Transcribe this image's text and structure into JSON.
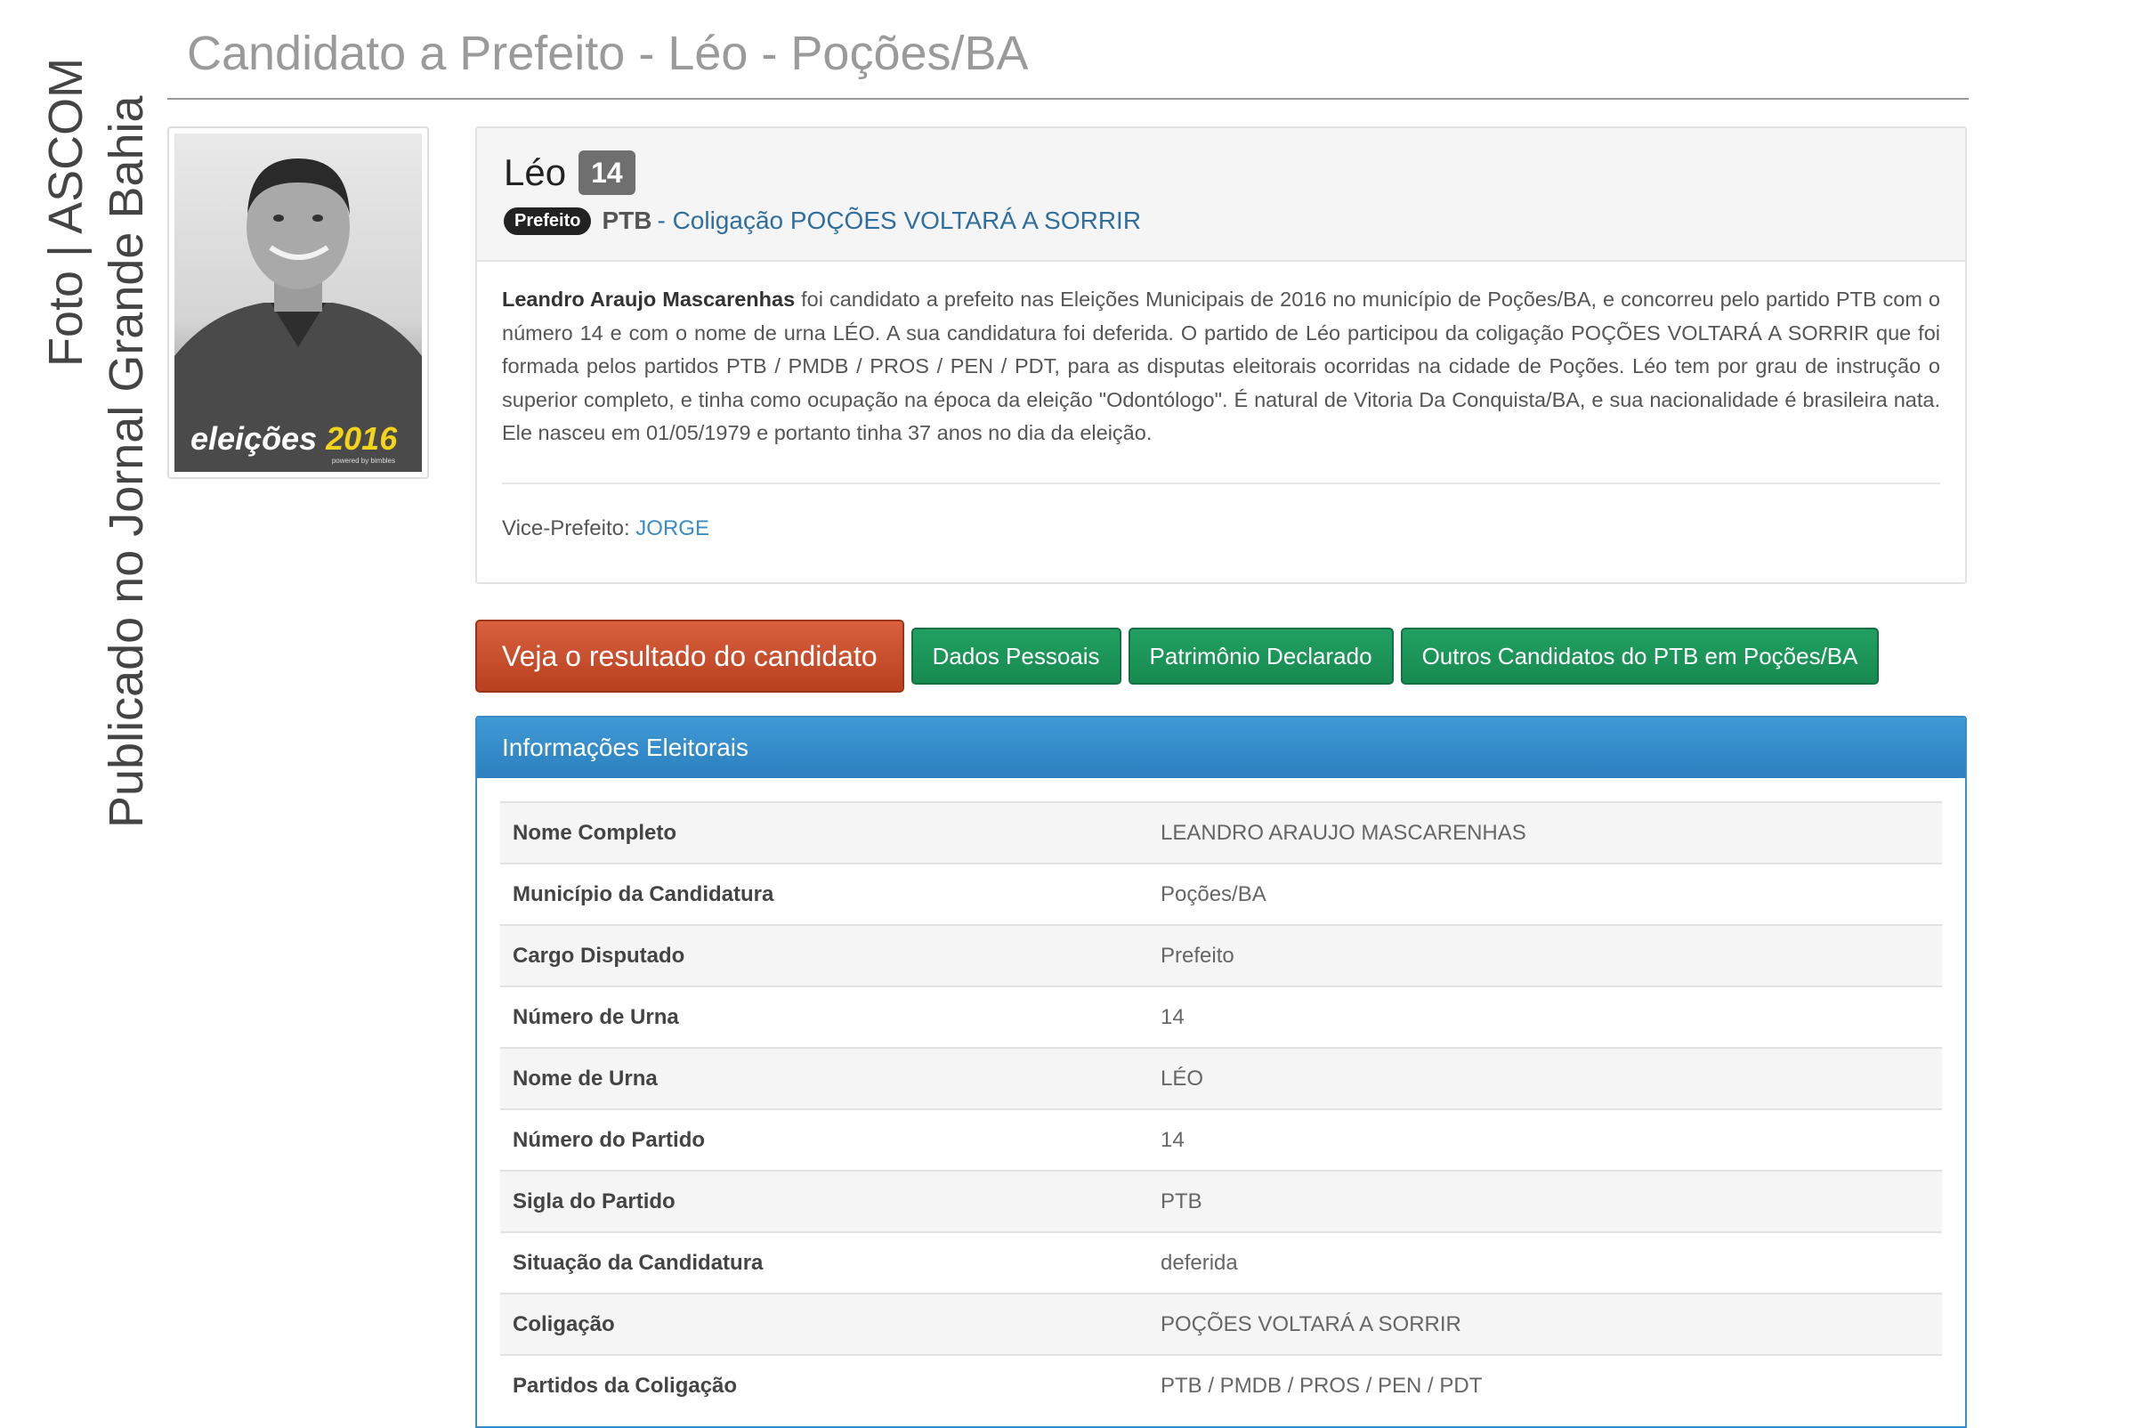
{
  "watermark": {
    "line1": "Foto | ASCOM",
    "line2": "Publicado no Jornal Grande Bahia"
  },
  "page": {
    "title": "Candidato a Prefeito - Léo - Poções/BA"
  },
  "photo": {
    "caption_word": "eleições",
    "caption_year": "2016",
    "caption_sub": "powered by bimbles"
  },
  "profile": {
    "name": "Léo",
    "number": "14",
    "role": "Prefeito",
    "party": "PTB",
    "coalition": "- Coligação POÇÕES VOLTARÁ A SORRIR",
    "bio_name": "Leandro Araujo Mascarenhas",
    "bio_text": " foi candidato a prefeito nas Eleições Municipais de 2016 no município de Poções/BA, e concorreu pelo partido PTB com o número 14 e com o nome de urna LÉO. A sua candidatura foi deferida. O partido de Léo participou da coligação POÇÕES VOLTARÁ A SORRIR que foi formada pelos partidos PTB / PMDB / PROS / PEN / PDT, para as disputas eleitorais ocorridas na cidade de Poções. Léo tem por grau de instrução o superior completo, e tinha como ocupação na época da eleição \"Odontólogo\". É natural de Vitoria Da Conquista/BA, e sua nacionalidade é brasileira nata. Ele nasceu em 01/05/1979 e portanto tinha 37 anos no dia da eleição.",
    "vice_label": "Vice-Prefeito: ",
    "vice_name": "JORGE"
  },
  "buttons": {
    "result": "Veja o resultado do candidato",
    "personal": "Dados Pessoais",
    "assets": "Patrimônio Declarado",
    "others": "Outros Candidatos do PTB em Poções/BA"
  },
  "info": {
    "title": "Informações Eleitorais",
    "rows": [
      {
        "label": "Nome Completo",
        "value": "LEANDRO ARAUJO MASCARENHAS"
      },
      {
        "label": "Município da Candidatura",
        "value": "Poções/BA"
      },
      {
        "label": "Cargo Disputado",
        "value": "Prefeito"
      },
      {
        "label": "Número de Urna",
        "value": "14"
      },
      {
        "label": "Nome de Urna",
        "value": "LÉO"
      },
      {
        "label": "Número do Partido",
        "value": "14"
      },
      {
        "label": "Sigla do Partido",
        "value": "PTB"
      },
      {
        "label": "Situação da Candidatura",
        "value": "deferida"
      },
      {
        "label": "Coligação",
        "value": "POÇÕES VOLTARÁ A SORRIR"
      },
      {
        "label": "Partidos da Coligação",
        "value": "PTB / PMDB / PROS / PEN / PDT"
      }
    ]
  },
  "colors": {
    "accent_blue": "#2c7fbe",
    "result_button": "#c24a27",
    "green_button": "#1a9257",
    "link": "#3a8cc4"
  }
}
